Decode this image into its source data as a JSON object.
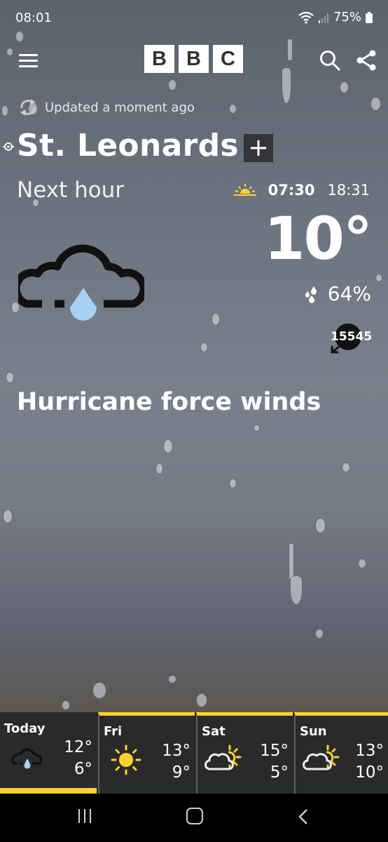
{
  "status_bar": {
    "time": "08:01",
    "battery": "75%"
  },
  "header": {
    "logo_letters": [
      "B",
      "B",
      "C"
    ]
  },
  "updated_text": "Updated a moment ago",
  "location": {
    "name": "St. Leonards"
  },
  "period_label": "Next hour",
  "sun": {
    "sunrise": "07:30",
    "sunset": "18:31"
  },
  "current": {
    "temperature": "10°",
    "humidity": "64%",
    "wind_speed": "15545",
    "condition_icon": "cloud-rain-icon",
    "headline": "Hurricane force winds"
  },
  "forecast": [
    {
      "day": "Today",
      "high": "12°",
      "low": "6°",
      "icon": "cloud-rain-icon"
    },
    {
      "day": "Fri",
      "high": "13°",
      "low": "9°",
      "icon": "sun-icon"
    },
    {
      "day": "Sat",
      "high": "15°",
      "low": "5°",
      "icon": "sun-cloud-icon"
    },
    {
      "day": "Sun",
      "high": "13°",
      "low": "10°",
      "icon": "sun-cloud-icon"
    }
  ],
  "colors": {
    "accent": "#ffd230",
    "raindrop": "#a8d0f0",
    "button_bg": "#333538"
  }
}
